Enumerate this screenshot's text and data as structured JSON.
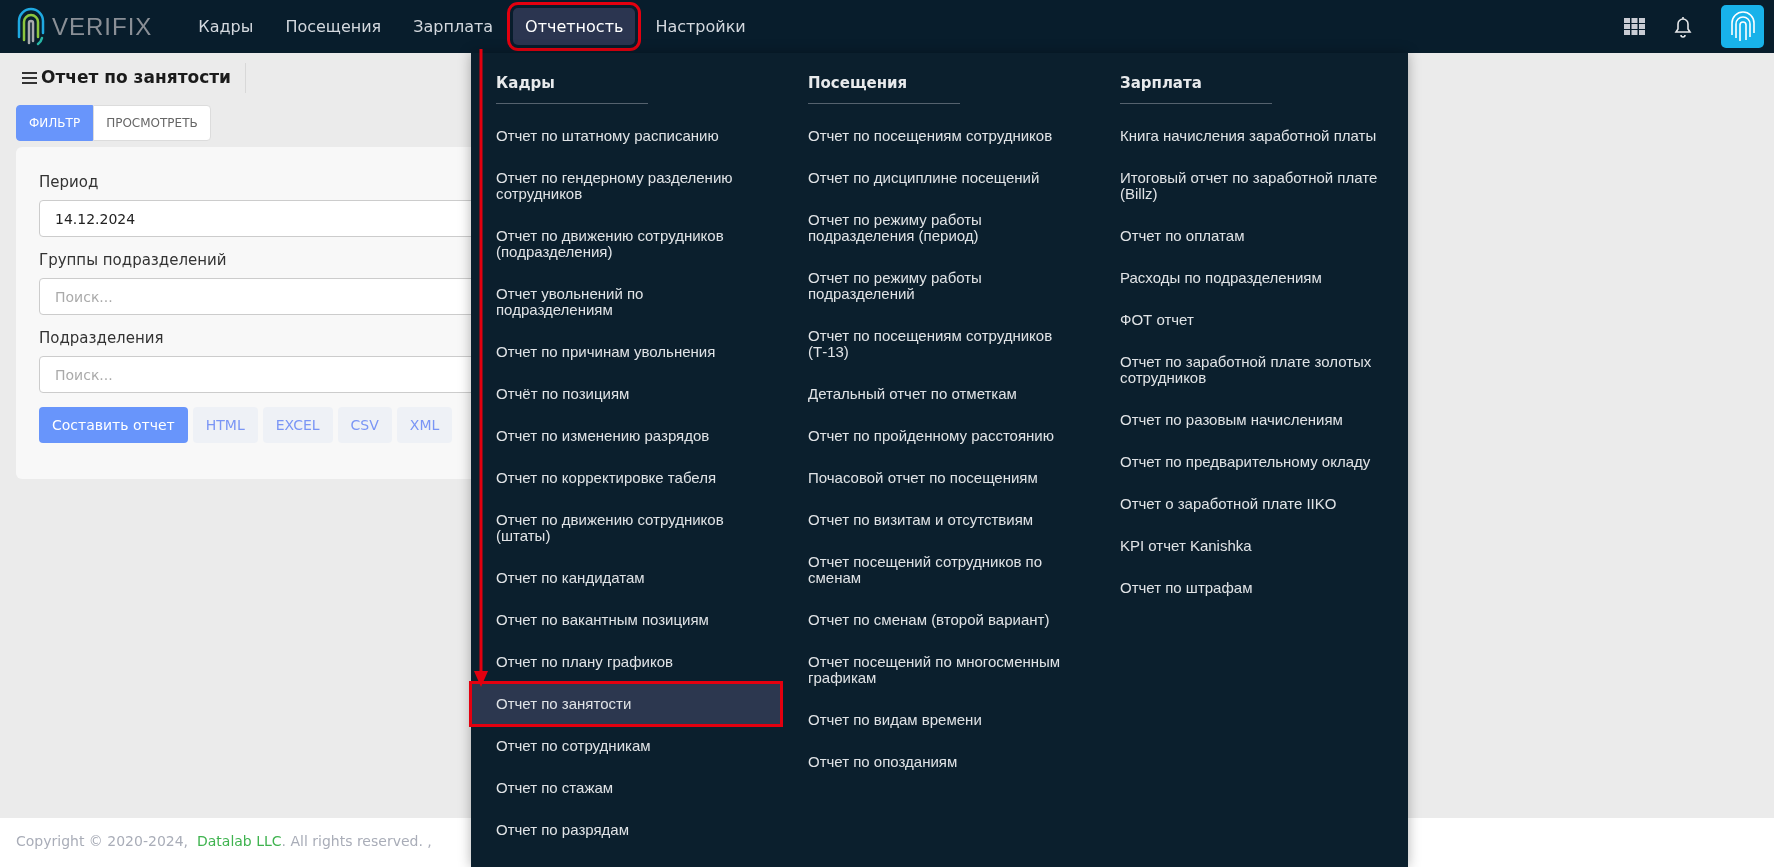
{
  "header": {
    "logo": "VERIFIX",
    "nav": [
      {
        "label": "Кадры",
        "selected": false,
        "highlighted": false
      },
      {
        "label": "Посещения",
        "selected": false,
        "highlighted": false
      },
      {
        "label": "Зарплата",
        "selected": false,
        "highlighted": false
      },
      {
        "label": "Отчетность",
        "selected": true,
        "highlighted": true
      },
      {
        "label": "Настройки",
        "selected": false,
        "highlighted": false
      }
    ]
  },
  "page": {
    "title": "Отчет по занятости",
    "tabs": [
      {
        "label": "ФИЛЬТР",
        "selected": true
      },
      {
        "label": "ПРОСМОТРЕТЬ",
        "selected": false
      }
    ],
    "fields": [
      {
        "label": "Период",
        "value": "14.12.2024"
      },
      {
        "label": "Группы подразделений",
        "placeholder": "Поиск..."
      },
      {
        "label": "Подразделения",
        "placeholder": "Поиск..."
      }
    ],
    "buttons": [
      {
        "label": "Составить отчет",
        "kind": "primary"
      },
      {
        "label": "HTML",
        "kind": "export"
      },
      {
        "label": "EXCEL",
        "kind": "export"
      },
      {
        "label": "CSV",
        "kind": "export"
      },
      {
        "label": "XML",
        "kind": "export"
      }
    ]
  },
  "menu": {
    "columns": [
      {
        "title": "Кадры",
        "items": [
          {
            "label": "Отчет по штатному расписанию",
            "selected": false,
            "highlighted": false
          },
          {
            "label": "Отчет по гендерному разделению сотрудников",
            "selected": false,
            "highlighted": false
          },
          {
            "label": "Отчет по движению сотрудников (подразделения)",
            "selected": false,
            "highlighted": false
          },
          {
            "label": "Отчет увольнений по подразделениям",
            "selected": false,
            "highlighted": false
          },
          {
            "label": "Отчет по причинам увольнения",
            "selected": false,
            "highlighted": false
          },
          {
            "label": "Отчёт по позициям",
            "selected": false,
            "highlighted": false
          },
          {
            "label": "Отчет по изменению разрядов",
            "selected": false,
            "highlighted": false
          },
          {
            "label": "Отчет по корректировке табеля",
            "selected": false,
            "highlighted": false
          },
          {
            "label": "Отчет по движению сотрудников (штаты)",
            "selected": false,
            "highlighted": false
          },
          {
            "label": "Отчет по кандидатам",
            "selected": false,
            "highlighted": false
          },
          {
            "label": "Отчет по вакантным позициям",
            "selected": false,
            "highlighted": false
          },
          {
            "label": "Отчет по плану графиков",
            "selected": false,
            "highlighted": false
          },
          {
            "label": "Отчет по занятости",
            "selected": true,
            "highlighted": true
          },
          {
            "label": "Отчет по сотрудникам",
            "selected": false,
            "highlighted": false
          },
          {
            "label": "Отчет по стажам",
            "selected": false,
            "highlighted": false
          },
          {
            "label": "Отчет по разрядам",
            "selected": false,
            "highlighted": false
          }
        ]
      },
      {
        "title": "Посещения",
        "items": [
          {
            "label": "Отчет по посещениям сотрудников",
            "selected": false,
            "highlighted": false
          },
          {
            "label": "Отчет по дисциплине посещений",
            "selected": false,
            "highlighted": false
          },
          {
            "label": "Отчет по режиму работы подразделения (период)",
            "selected": false,
            "highlighted": false
          },
          {
            "label": "Отчет по режиму работы подразделений",
            "selected": false,
            "highlighted": false
          },
          {
            "label": "Отчет по посещениям сотрудников (Т-13)",
            "selected": false,
            "highlighted": false
          },
          {
            "label": "Детальный отчет по отметкам",
            "selected": false,
            "highlighted": false
          },
          {
            "label": "Отчет по пройденному расстоянию",
            "selected": false,
            "highlighted": false
          },
          {
            "label": "Почасовой отчет по посещениям",
            "selected": false,
            "highlighted": false
          },
          {
            "label": "Отчет по визитам и отсутствиям",
            "selected": false,
            "highlighted": false
          },
          {
            "label": "Отчет посещений сотрудников по сменам",
            "selected": false,
            "highlighted": false
          },
          {
            "label": "Отчет по сменам (второй вариант)",
            "selected": false,
            "highlighted": false
          },
          {
            "label": "Отчет посещений по многосменным графикам",
            "selected": false,
            "highlighted": false
          },
          {
            "label": "Отчет по видам времени",
            "selected": false,
            "highlighted": false
          },
          {
            "label": "Отчет по опозданиям",
            "selected": false,
            "highlighted": false
          }
        ]
      },
      {
        "title": "Зарплата",
        "items": [
          {
            "label": "Книга начисления заработной платы",
            "selected": false,
            "highlighted": false
          },
          {
            "label": "Итоговый отчет по заработной плате (Billz)",
            "selected": false,
            "highlighted": false
          },
          {
            "label": "Отчет по оплатам",
            "selected": false,
            "highlighted": false
          },
          {
            "label": "Расходы по подразделениям",
            "selected": false,
            "highlighted": false
          },
          {
            "label": "ФОТ отчет",
            "selected": false,
            "highlighted": false
          },
          {
            "label": "Отчет по заработной плате золотых сотрудников",
            "selected": false,
            "highlighted": false
          },
          {
            "label": "Отчет по разовым начислениям",
            "selected": false,
            "highlighted": false
          },
          {
            "label": "Отчет по предварительному окладу",
            "selected": false,
            "highlighted": false
          },
          {
            "label": "Отчет о заработной плате IIKO",
            "selected": false,
            "highlighted": false
          },
          {
            "label": "KPI отчет Kanishka",
            "selected": false,
            "highlighted": false
          },
          {
            "label": "Отчет по штрафам",
            "selected": false,
            "highlighted": false
          }
        ]
      }
    ]
  },
  "footer": {
    "text": "Copyright © 2020-2024,",
    "link": "Datalab LLC",
    "suffix": ". All rights reserved. ,"
  }
}
